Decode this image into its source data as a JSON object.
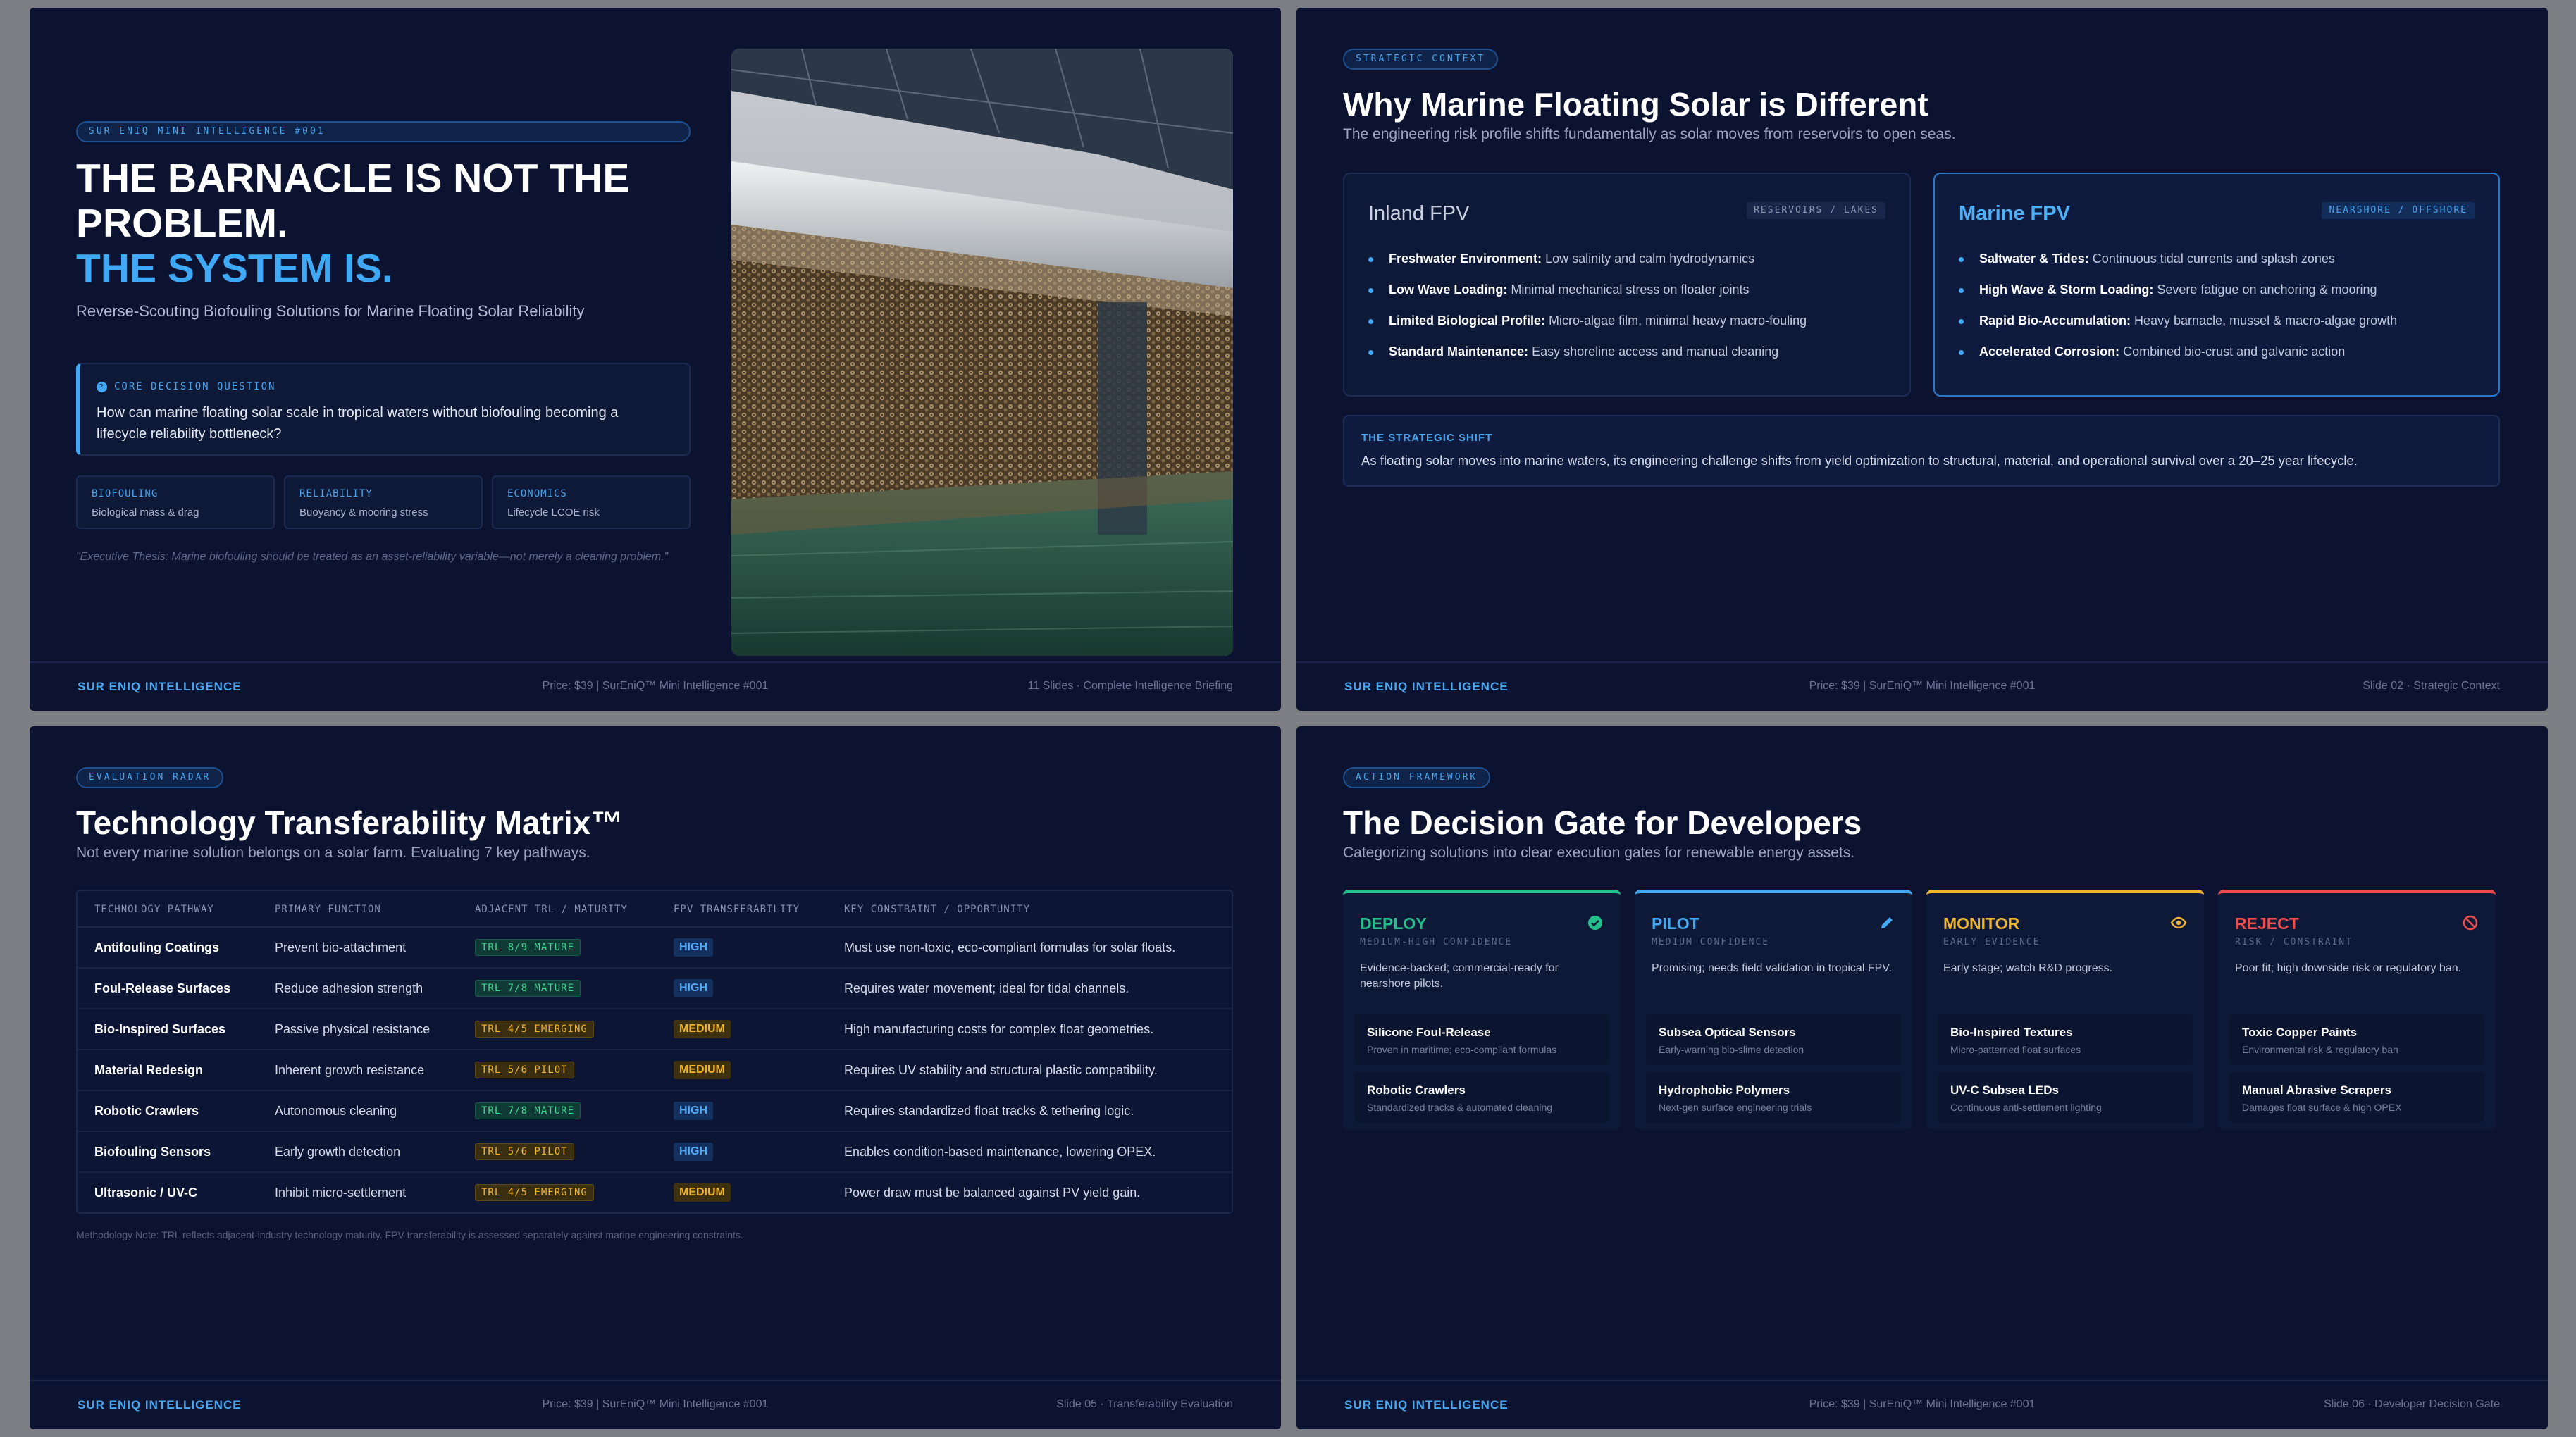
{
  "footer": {
    "brand": "SUR ENIQ INTELLIGENCE",
    "price": "Price: $39 | SurEniQ™ Mini Intelligence #001",
    "slide1_right": "11 Slides · Complete Intelligence Briefing",
    "slide2_price": "Price: $39 | SurEniQ™ Mini Intelligence #001",
    "slide2_right": "Slide 02 · Strategic Context",
    "slide3_right": "Slide 05 · Transferability Evaluation",
    "slide4_right": "Slide 06 · Developer Decision Gate"
  },
  "slide1": {
    "tag": "SUR ENIQ MINI INTELLIGENCE #001",
    "headline_line1": "THE BARNACLE IS NOT THE",
    "headline_line2": "PROBLEM.",
    "headline_line3": "THE SYSTEM IS.",
    "tagline": "Reverse-Scouting Biofouling Solutions for Marine Floating Solar Reliability",
    "question_label": "CORE DECISION QUESTION",
    "question_text": "How can marine floating solar scale in tropical waters without biofouling becoming a lifecycle reliability bottleneck?",
    "chips": [
      {
        "title": "BIOFOULING",
        "desc": "Biological mass & drag"
      },
      {
        "title": "RELIABILITY",
        "desc": "Buoyancy & mooring stress"
      },
      {
        "title": "ECONOMICS",
        "desc": "Lifecycle LCOE risk"
      }
    ],
    "thesis": "\"Executive Thesis: Marine biofouling should be treated as an asset-reliability variable—not merely a cleaning problem.\""
  },
  "slide2": {
    "tag": "STRATEGIC CONTEXT",
    "title": "Why Marine Floating Solar is Different",
    "subtitle": "The engineering risk profile shifts fundamentally as solar moves from reservoirs to open seas.",
    "inland": {
      "title": "Inland FPV",
      "badge": "RESERVOIRS / LAKES",
      "items": [
        {
          "k": "Freshwater Environment:",
          "v": "Low salinity and calm hydrodynamics"
        },
        {
          "k": "Low Wave Loading:",
          "v": "Minimal mechanical stress on floater joints"
        },
        {
          "k": "Limited Biological Profile:",
          "v": "Micro-algae film, minimal heavy macro-fouling"
        },
        {
          "k": "Standard Maintenance:",
          "v": "Easy shoreline access and manual cleaning"
        }
      ]
    },
    "marine": {
      "title": "Marine FPV",
      "badge": "NEARSHORE / OFFSHORE",
      "items": [
        {
          "k": "Saltwater & Tides:",
          "v": "Continuous tidal currents and splash zones"
        },
        {
          "k": "High Wave & Storm Loading:",
          "v": "Severe fatigue on anchoring & mooring"
        },
        {
          "k": "Rapid Bio-Accumulation:",
          "v": "Heavy barnacle, mussel & macro-algae growth"
        },
        {
          "k": "Accelerated Corrosion:",
          "v": "Combined bio-crust and galvanic action"
        }
      ]
    },
    "shift_label": "THE STRATEGIC SHIFT",
    "shift_text": "As floating solar moves into marine waters, its engineering challenge shifts from yield optimization to structural, material, and operational survival over a 20–25 year lifecycle."
  },
  "slide3": {
    "tag": "EVALUATION RADAR",
    "title": "Technology Transferability Matrix™",
    "subtitle": "Not every marine solution belongs on a solar farm. Evaluating 7 key pathways.",
    "headers": [
      "TECHNOLOGY PATHWAY",
      "PRIMARY FUNCTION",
      "ADJACENT TRL / MATURITY",
      "FPV TRANSFERABILITY",
      "KEY CONSTRAINT / OPPORTUNITY"
    ],
    "rows": [
      {
        "pathway": "Antifouling Coatings",
        "function": "Prevent bio-attachment",
        "trl": "TRL 8/9 MATURE",
        "trl_kind": "mature",
        "transfer": "HIGH",
        "transfer_kind": "high",
        "constraint": "Must use non-toxic, eco-compliant formulas for solar floats."
      },
      {
        "pathway": "Foul-Release Surfaces",
        "function": "Reduce adhesion strength",
        "trl": "TRL 7/8 MATURE",
        "trl_kind": "mature",
        "transfer": "HIGH",
        "transfer_kind": "high",
        "constraint": "Requires water movement; ideal for tidal channels."
      },
      {
        "pathway": "Bio-Inspired Surfaces",
        "function": "Passive physical resistance",
        "trl": "TRL 4/5 EMERGING",
        "trl_kind": "emerging",
        "transfer": "MEDIUM",
        "transfer_kind": "medium",
        "constraint": "High manufacturing costs for complex float geometries."
      },
      {
        "pathway": "Material Redesign",
        "function": "Inherent growth resistance",
        "trl": "TRL 5/6 PILOT",
        "trl_kind": "pilot",
        "transfer": "MEDIUM",
        "transfer_kind": "medium",
        "constraint": "Requires UV stability and structural plastic compatibility."
      },
      {
        "pathway": "Robotic Crawlers",
        "function": "Autonomous cleaning",
        "trl": "TRL 7/8 MATURE",
        "trl_kind": "mature",
        "transfer": "HIGH",
        "transfer_kind": "high",
        "constraint": "Requires standardized float tracks & tethering logic."
      },
      {
        "pathway": "Biofouling Sensors",
        "function": "Early growth detection",
        "trl": "TRL 5/6 PILOT",
        "trl_kind": "pilot",
        "transfer": "HIGH",
        "transfer_kind": "high",
        "constraint": "Enables condition-based maintenance, lowering OPEX."
      },
      {
        "pathway": "Ultrasonic / UV-C",
        "function": "Inhibit micro-settlement",
        "trl": "TRL 4/5 EMERGING",
        "trl_kind": "emerging",
        "transfer": "MEDIUM",
        "transfer_kind": "medium",
        "constraint": "Power draw must be balanced against PV yield gain."
      }
    ],
    "method_note": "Methodology Note: TRL reflects adjacent-industry technology maturity. FPV transferability is assessed separately against marine engineering constraints."
  },
  "slide4": {
    "tag": "ACTION FRAMEWORK",
    "title": "The Decision Gate for Developers",
    "subtitle": "Categorizing solutions into clear execution gates for renewable energy assets.",
    "gates": [
      {
        "title": "DEPLOY",
        "confidence": "MEDIUM-HIGH CONFIDENCE",
        "color": "#22c08a",
        "icon": "check-circle-icon",
        "desc": "Evidence-backed; commercial-ready for nearshore pilots.",
        "items": [
          {
            "t": "Silicone Foul-Release",
            "d": "Proven in maritime; eco-compliant formulas"
          },
          {
            "t": "Robotic Crawlers",
            "d": "Standardized tracks & automated cleaning"
          }
        ]
      },
      {
        "title": "PILOT",
        "confidence": "MEDIUM CONFIDENCE",
        "color": "#3fa9f5",
        "icon": "pencil-icon",
        "desc": "Promising; needs field validation in tropical FPV.",
        "items": [
          {
            "t": "Subsea Optical Sensors",
            "d": "Early-warning bio-slime detection"
          },
          {
            "t": "Hydrophobic Polymers",
            "d": "Next-gen surface engineering trials"
          }
        ]
      },
      {
        "title": "MONITOR",
        "confidence": "EARLY EVIDENCE",
        "color": "#f1b52c",
        "icon": "eye-icon",
        "desc": "Early stage; watch R&D progress.",
        "items": [
          {
            "t": "Bio-Inspired Textures",
            "d": "Micro-patterned float surfaces"
          },
          {
            "t": "UV-C Subsea LEDs",
            "d": "Continuous anti-settlement lighting"
          }
        ]
      },
      {
        "title": "REJECT",
        "confidence": "RISK / CONSTRAINT",
        "color": "#ef4d4d",
        "icon": "ban-icon",
        "desc": "Poor fit; high downside risk or regulatory ban.",
        "items": [
          {
            "t": "Toxic Copper Paints",
            "d": "Environmental risk & regulatory ban"
          },
          {
            "t": "Manual Abrasive Scrapers",
            "d": "Damages float surface & high OPEX"
          }
        ]
      }
    ]
  }
}
